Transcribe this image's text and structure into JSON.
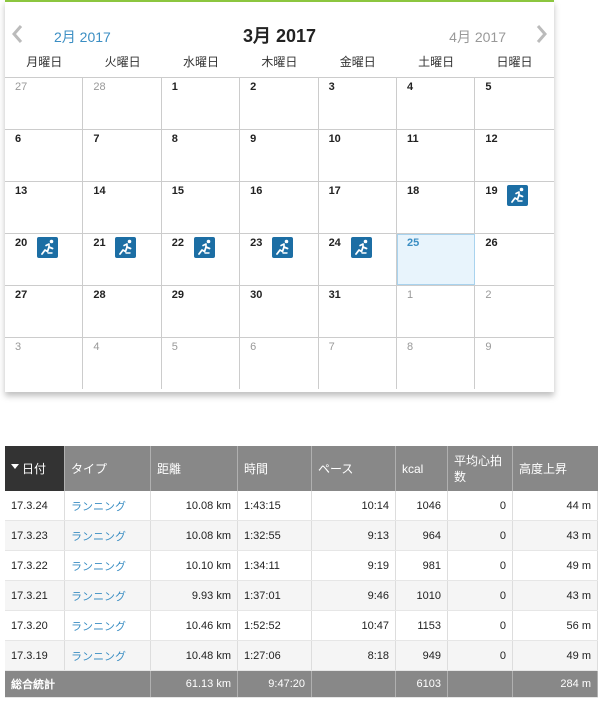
{
  "calendar": {
    "title": "3月 2017",
    "prev_month": "2月 2017",
    "next_month": "4月 2017",
    "weekdays": [
      "月曜日",
      "火曜日",
      "水曜日",
      "木曜日",
      "金曜日",
      "土曜日",
      "日曜日"
    ],
    "weeks": [
      [
        {
          "n": "27",
          "other": true
        },
        {
          "n": "28",
          "other": true
        },
        {
          "n": "1"
        },
        {
          "n": "2"
        },
        {
          "n": "3"
        },
        {
          "n": "4"
        },
        {
          "n": "5"
        }
      ],
      [
        {
          "n": "6"
        },
        {
          "n": "7"
        },
        {
          "n": "8"
        },
        {
          "n": "9"
        },
        {
          "n": "10"
        },
        {
          "n": "11"
        },
        {
          "n": "12"
        }
      ],
      [
        {
          "n": "13"
        },
        {
          "n": "14"
        },
        {
          "n": "15"
        },
        {
          "n": "16"
        },
        {
          "n": "17"
        },
        {
          "n": "18"
        },
        {
          "n": "19",
          "run": true
        }
      ],
      [
        {
          "n": "20",
          "run": true
        },
        {
          "n": "21",
          "run": true
        },
        {
          "n": "22",
          "run": true
        },
        {
          "n": "23",
          "run": true
        },
        {
          "n": "24",
          "run": true
        },
        {
          "n": "25",
          "today": true
        },
        {
          "n": "26"
        }
      ],
      [
        {
          "n": "27"
        },
        {
          "n": "28"
        },
        {
          "n": "29"
        },
        {
          "n": "30"
        },
        {
          "n": "31"
        },
        {
          "n": "1",
          "other": true
        },
        {
          "n": "2",
          "other": true
        }
      ],
      [
        {
          "n": "3",
          "other": true
        },
        {
          "n": "4",
          "other": true
        },
        {
          "n": "5",
          "other": true
        },
        {
          "n": "6",
          "other": true
        },
        {
          "n": "7",
          "other": true
        },
        {
          "n": "8",
          "other": true
        },
        {
          "n": "9",
          "other": true
        }
      ]
    ],
    "run_icon": "running-activity-icon"
  },
  "table": {
    "headers": [
      "日付",
      "タイプ",
      "距離",
      "時間",
      "ペース",
      "kcal",
      "平均心拍数",
      "高度上昇"
    ],
    "rows": [
      {
        "date": "17.3.24",
        "type": "ランニング",
        "distance": "10.08 km",
        "time": "1:43:15",
        "pace": "10:14",
        "kcal": "1046",
        "hr": "0",
        "elev": "44 m"
      },
      {
        "date": "17.3.23",
        "type": "ランニング",
        "distance": "10.08 km",
        "time": "1:32:55",
        "pace": "9:13",
        "kcal": "964",
        "hr": "0",
        "elev": "43 m"
      },
      {
        "date": "17.3.22",
        "type": "ランニング",
        "distance": "10.10 km",
        "time": "1:34:11",
        "pace": "9:19",
        "kcal": "981",
        "hr": "0",
        "elev": "49 m"
      },
      {
        "date": "17.3.21",
        "type": "ランニング",
        "distance": "9.93 km",
        "time": "1:37:01",
        "pace": "9:46",
        "kcal": "1010",
        "hr": "0",
        "elev": "43 m"
      },
      {
        "date": "17.3.20",
        "type": "ランニング",
        "distance": "10.46 km",
        "time": "1:52:52",
        "pace": "10:47",
        "kcal": "1153",
        "hr": "0",
        "elev": "56 m"
      },
      {
        "date": "17.3.19",
        "type": "ランニング",
        "distance": "10.48 km",
        "time": "1:27:06",
        "pace": "8:18",
        "kcal": "949",
        "hr": "0",
        "elev": "49 m"
      }
    ],
    "total": {
      "label": "総合統計",
      "distance": "61.13 km",
      "time": "9:47:20",
      "kcal": "6103",
      "elev": "284 m"
    }
  },
  "colors": {
    "accent": "#3b8ec3",
    "icon_bg": "#1c6ea4",
    "header_bg": "#888888",
    "sorted_header_bg": "#333333",
    "top_border": "#8cc63f"
  }
}
